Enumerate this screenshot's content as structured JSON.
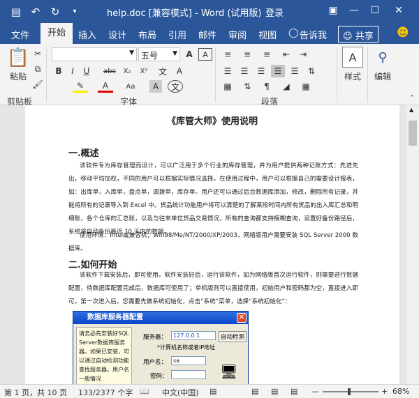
{
  "titlebar": {
    "doc_title": "help.doc [兼容模式] - Word (试用版)",
    "login": "登录",
    "save_icon": "save-icon",
    "undo_icon": "undo-icon",
    "redo_icon": "redo-icon"
  },
  "tabs": {
    "file": "文件",
    "home": "开始",
    "insert": "插入",
    "design": "设计",
    "layout": "布局",
    "references": "引用",
    "mailings": "邮件",
    "review": "审阅",
    "view": "视图",
    "tellme": "告诉我",
    "share": "共享"
  },
  "ribbon": {
    "paste": "粘贴",
    "clipboard": "剪贴板",
    "font": "字体",
    "paragraph": "段落",
    "styles": "样式",
    "editing": "编辑",
    "font_size": "五号",
    "bold": "B",
    "italic": "I",
    "underline": "U",
    "strike": "abc",
    "subscript": "X₂",
    "superscript": "X²",
    "wen": "文",
    "font_a": "A",
    "aa": "Aa",
    "aword": "A",
    "phonetic": "wén",
    "pinyin_a": "A"
  },
  "document": {
    "title": "《库管大师》使用说明",
    "h1": "一.概述",
    "p1": "该软件专为库存管理而设计，可以广泛用于多个行业的库存管理，并为用户提供两种记账方式：先进先出，移动平均加权，不同的用户可以根据实际情况选择。在使用过程中，用户可以根据自己的需要设计报表，如：出库单，入库单，盘点单，调拨单，库存单。用户还可以通过后台数据库添加，修改，删除所有记录，并能将所有的记录导入到 Excel 中。货品统计功能用户将可以清楚的了解某段时间内所有货品的出入库汇总和明细账，各个仓库的汇总账，以及与往来单位货品交易情况，所有的查询都支持模糊查询，设置好备份路径后，系统将自动备份最近 10 天内的数据。",
    "p2": "使用环境：Intel或兼容机；Win98/Me/NT/2000/XP/2003，网络版用户需要安装 SQL Server 2000 数据库。",
    "h2": "二.如何开始",
    "p3": "该软件下载安装后，即可使用，软件安装好后，运行该软件，如为网络版首次运行软件，则需要进行数据配置，待数据库配置完成后，数据库可使用了；单机版则可以直接使用，初始用户和密码都为空，直接进入即可，第一次进入后，您需要先做系统初始化，点击“系统”菜单，选择“系统初始化”："
  },
  "dialog": {
    "title": "数据库服务器配置",
    "note": "请务必先安装好SQL Server数据库服务器。如果已安装，可以通过自动检测功能查找服务器。用户名一般情况",
    "server_label": "服务器：",
    "server_value": "127.0.0.1",
    "detect": "自动检测",
    "hint": "*计算机名称或者IP地址",
    "user_label": "用户名：",
    "user_value": "sa",
    "pwd_label": "密码："
  },
  "status": {
    "page": "第 1 页，共 10 页",
    "words": "133/2377 个字",
    "lang": "中文(中国)",
    "zoom": "68%"
  },
  "colors": {
    "accent": "#2b579a",
    "ribbon": "#f3f3f3"
  }
}
